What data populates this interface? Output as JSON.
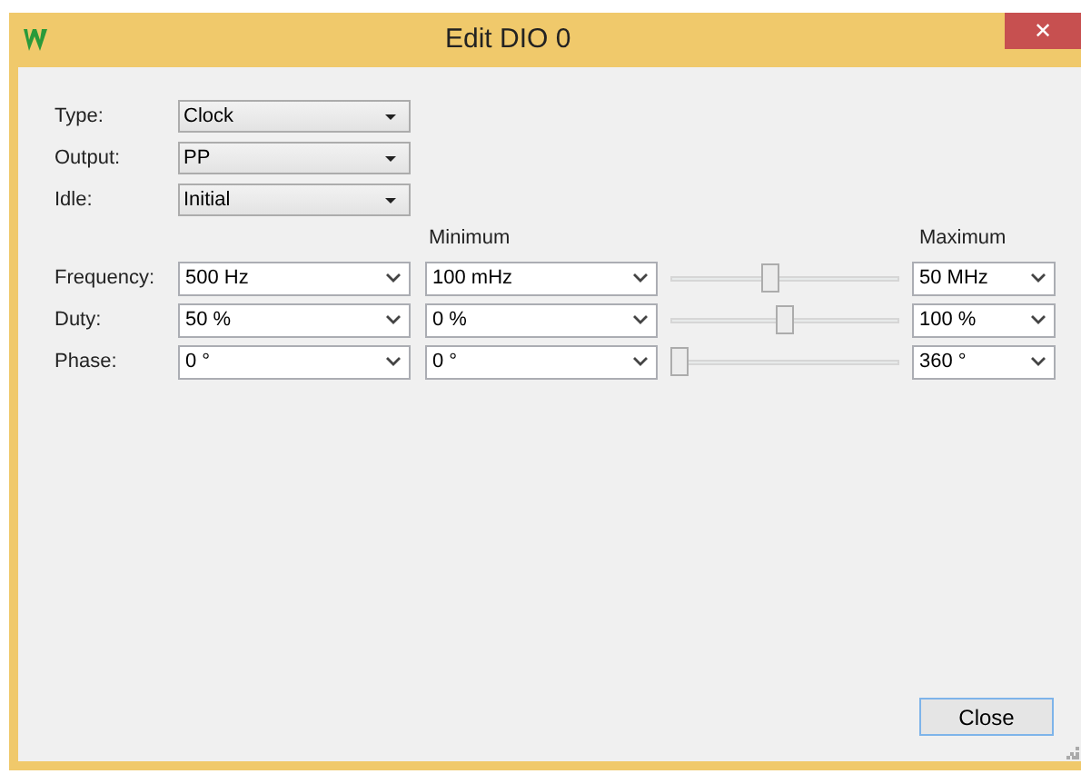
{
  "window": {
    "title": "Edit DIO  0",
    "close_glyph": "✕"
  },
  "fields": [
    {
      "label": "Type:",
      "value": "Clock"
    },
    {
      "label": "Output:",
      "value": "PP"
    },
    {
      "label": "Idle:",
      "value": "Initial"
    }
  ],
  "columns": {
    "minimum": "Minimum",
    "maximum": "Maximum"
  },
  "parameters": [
    {
      "label": "Frequency:",
      "value": "500 Hz",
      "minimum": "100 mHz",
      "level": 0.43,
      "maximum": "50 MHz"
    },
    {
      "label": "Duty:",
      "value": "50 %",
      "minimum": "0 %",
      "level": 0.5,
      "maximum": "100 %"
    },
    {
      "label": "Phase:",
      "value": "0 °",
      "minimum": "0 °",
      "level": 0,
      "maximum": "360 °"
    }
  ],
  "buttons": [
    {
      "label": "Close"
    }
  ]
}
